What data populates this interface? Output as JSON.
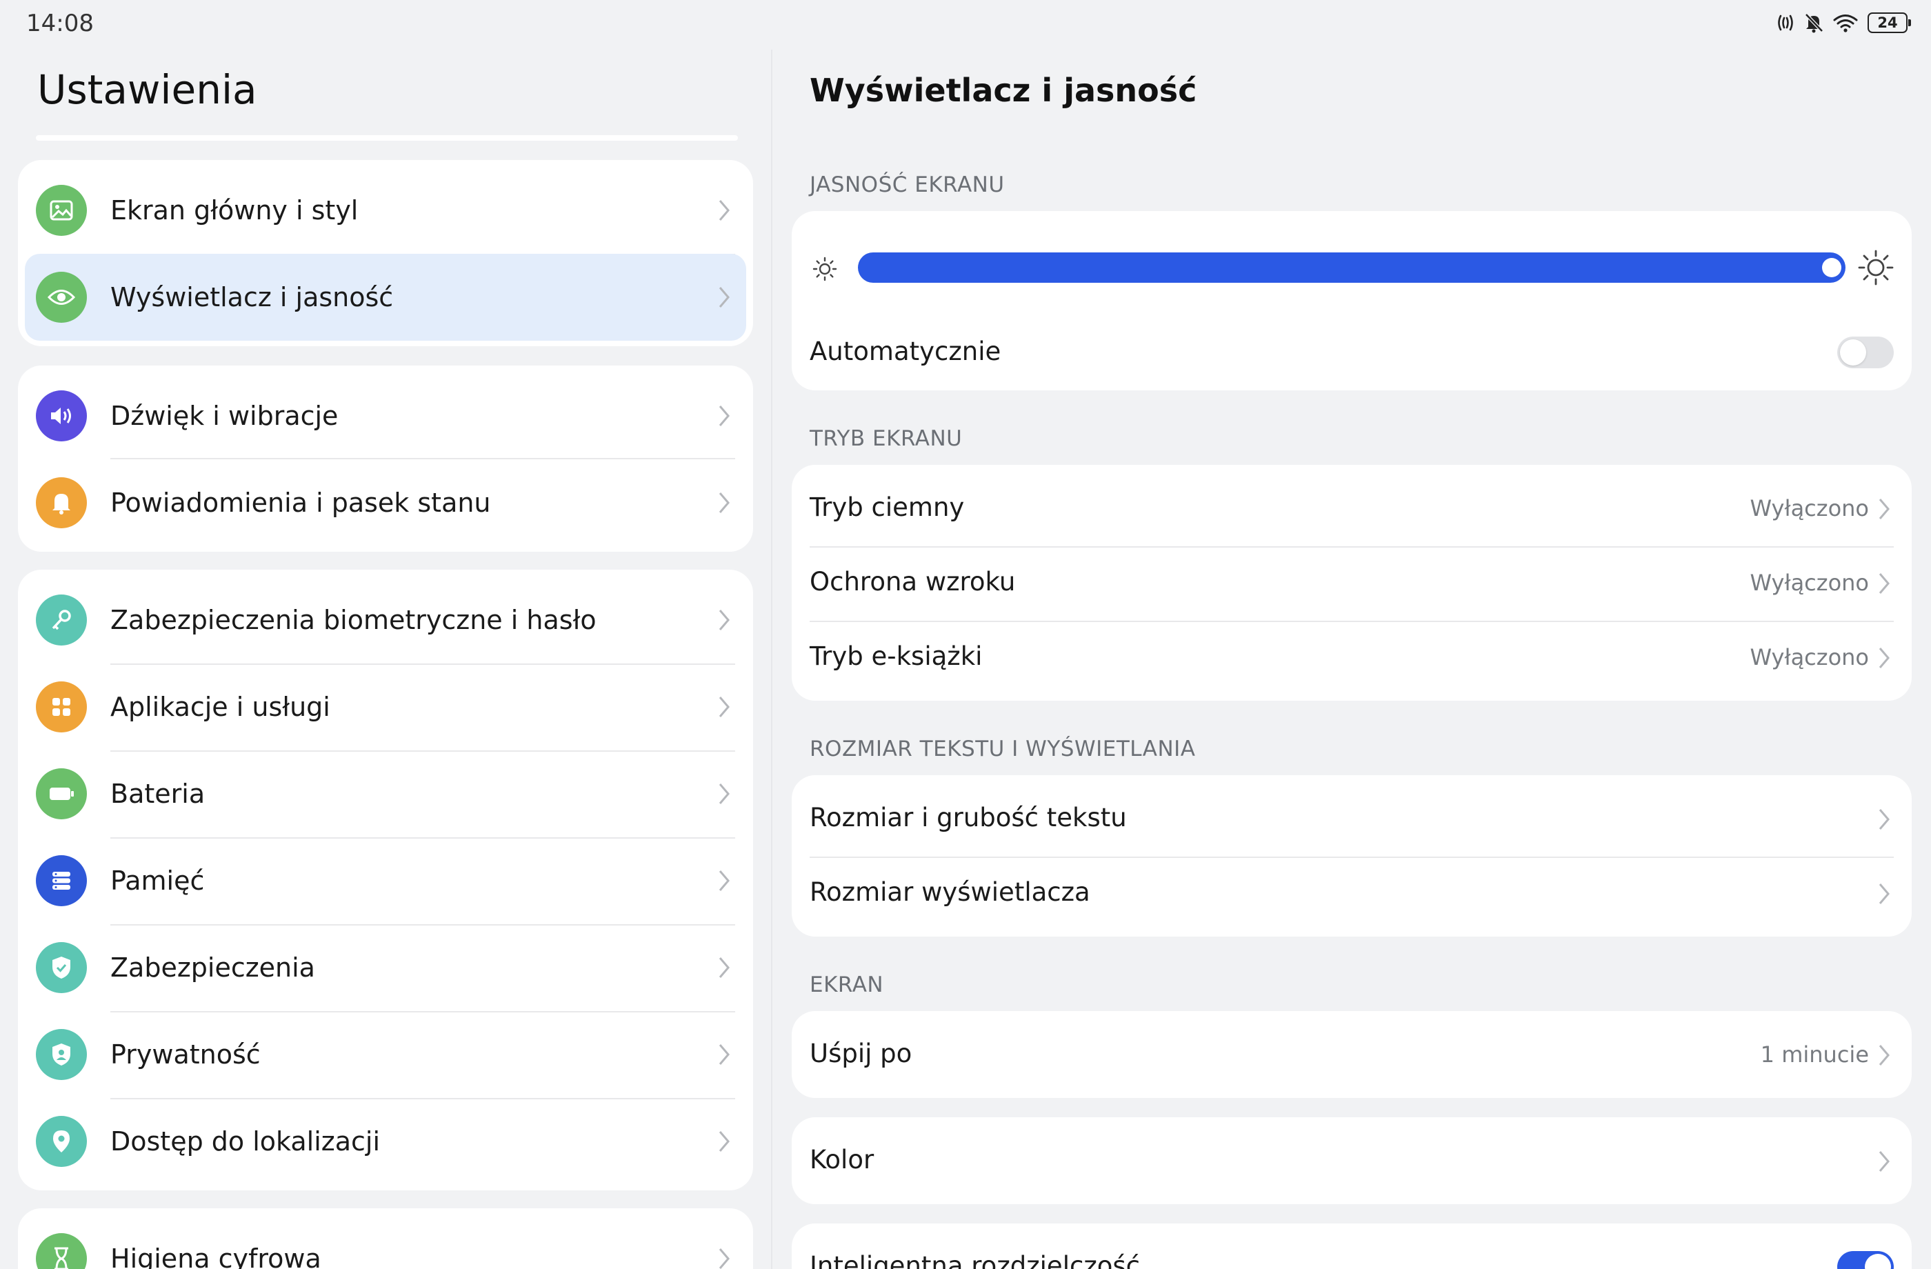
{
  "status_bar": {
    "time": "14:08",
    "icons": [
      "nfc-icon",
      "mute-icon",
      "wifi-icon",
      "battery-icon"
    ],
    "battery": "24"
  },
  "left": {
    "title": "Ustawienia",
    "groups": [
      {
        "items": [
          {
            "label": "Ekran główny i styl",
            "icon": "image-icon",
            "color": "#6bbf6a"
          },
          {
            "label": "Wyświetlacz i jasność",
            "icon": "eye-icon",
            "color": "#6bbf6a",
            "selected": true
          }
        ]
      },
      {
        "items": [
          {
            "label": "Dźwięk i wibracje",
            "icon": "speaker-icon",
            "color": "#5b4de0"
          },
          {
            "label": "Powiadomienia i pasek stanu",
            "icon": "bell-icon",
            "color": "#f0a438"
          }
        ]
      },
      {
        "items": [
          {
            "label": "Zabezpieczenia biometryczne i hasło",
            "icon": "key-icon",
            "color": "#5cc6b3"
          },
          {
            "label": "Aplikacje i usługi",
            "icon": "apps-icon",
            "color": "#f0a438"
          },
          {
            "label": "Bateria",
            "icon": "battery-icon",
            "color": "#6bbf6a"
          },
          {
            "label": "Pamięć",
            "icon": "storage-icon",
            "color": "#2f58d8"
          },
          {
            "label": "Zabezpieczenia",
            "icon": "shield-check-icon",
            "color": "#5cc6b3"
          },
          {
            "label": "Prywatność",
            "icon": "privacy-icon",
            "color": "#5cc6b3"
          },
          {
            "label": "Dostęp do lokalizacji",
            "icon": "location-icon",
            "color": "#5cc6b3"
          }
        ]
      },
      {
        "items": [
          {
            "label": "Higiena cyfrowa",
            "icon": "hourglass-icon",
            "color": "#6bbf6a"
          }
        ]
      }
    ]
  },
  "right": {
    "title": "Wyświetlacz i jasność",
    "brightness": {
      "header": "JASNOŚĆ EKRANU",
      "level": 1.0,
      "auto_label": "Automatycznie",
      "auto_enabled": false
    },
    "mode": {
      "header": "TRYB EKRANU",
      "rows": [
        {
          "label": "Tryb ciemny",
          "value": "Wyłączono"
        },
        {
          "label": "Ochrona wzroku",
          "value": "Wyłączono"
        },
        {
          "label": "Tryb e-książki",
          "value": "Wyłączono"
        }
      ]
    },
    "text_size": {
      "header": "ROZMIAR TEKSTU I WYŚWIETLANIA",
      "rows": [
        {
          "label": "Rozmiar i grubość tekstu"
        },
        {
          "label": "Rozmiar wyświetlacza"
        }
      ]
    },
    "screen": {
      "header": "EKRAN",
      "sleep_label": "Uśpij po",
      "sleep_value": "1 minucie"
    },
    "color_label": "Kolor",
    "smart_res_label": "Inteligentna rozdzielczość",
    "smart_res_enabled": true
  },
  "colors": {
    "accent": "#2b59e4",
    "selected_bg": "#e3edfb"
  }
}
